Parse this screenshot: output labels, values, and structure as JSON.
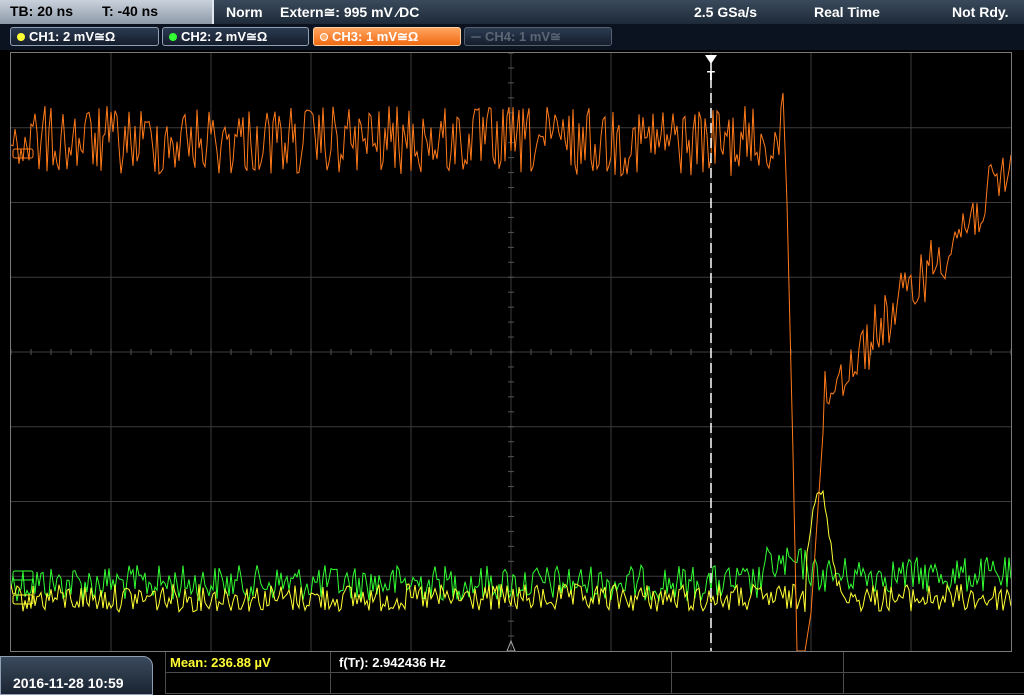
{
  "topbar": {
    "tb": "TB: 20 ns",
    "t": "T: -40 ns",
    "mode": "Norm",
    "trigger": "Extern≅: 995 mV ⁄DC",
    "rate": "2.5 GSa/s",
    "acq": "Real Time",
    "status": "Not Rdy."
  },
  "channels": [
    {
      "label": "CH1: 2 mV≅Ω",
      "color": "#ffff33",
      "state": "on"
    },
    {
      "label": "CH2: 2 mV≅Ω",
      "color": "#33ff33",
      "state": "on"
    },
    {
      "label": "CH3: 1 mV≅Ω",
      "color": "#ff7a1a",
      "state": "active"
    },
    {
      "label": "CH4: 1 mV≅",
      "color": "#4a5565",
      "state": "off"
    }
  ],
  "markers": {
    "trigger": "T"
  },
  "bottom": {
    "datetime": "2016-11-28 10:59",
    "mean": "Mean: 236.88 µV",
    "freq": "f(Tr): 2.942436 Hz"
  },
  "colors": {
    "ch1": "#ffff33",
    "ch2": "#33ff33",
    "ch3": "#ff7a1a",
    "grid": "#3c3c3c"
  }
}
